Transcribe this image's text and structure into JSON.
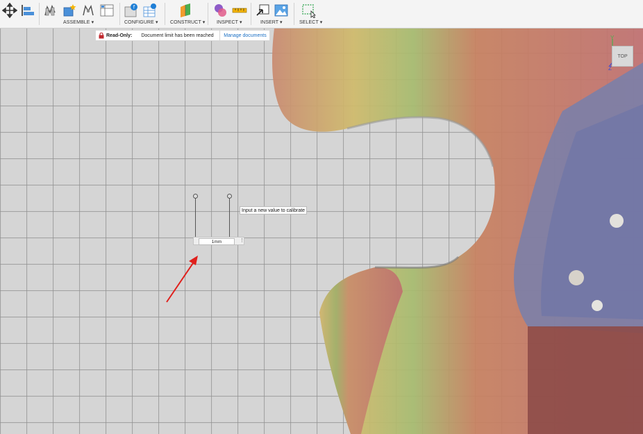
{
  "toolbar": {
    "groups": [
      {
        "label": "ASSEMBLE ▾"
      },
      {
        "label": "CONFIGURE ▾"
      },
      {
        "label": "CONSTRUCT ▾"
      },
      {
        "label": "INSPECT ▾"
      },
      {
        "label": "INSERT ▾"
      },
      {
        "label": "SELECT ▾"
      }
    ],
    "icons": [
      "move-icon",
      "align-icon",
      "new-component-icon",
      "joint-icon",
      "as-built-joint-icon",
      "joint-origin-icon",
      "rigid-group-icon",
      "configure-parameters-icon",
      "configure-table-icon",
      "offset-plane-icon",
      "measure-icon",
      "interference-icon",
      "insert-derive-icon",
      "canvas-icon",
      "window-select-icon"
    ]
  },
  "banner": {
    "read_only": "Read-Only:",
    "message": "Document limit has been reached",
    "manage": "Manage documents"
  },
  "calibrate": {
    "tooltip": "Input a new value to calibrate",
    "value": "1mm",
    "menu": "⋮"
  },
  "viewcube": {
    "face": "TOP",
    "axis_y": "Y",
    "axis_z": "Z"
  },
  "colors": {
    "toolbar_bg": "#f4f4f4",
    "link_blue": "#1a6fc4",
    "lock_red": "#c0272d",
    "arrow_red": "#e0201c"
  }
}
